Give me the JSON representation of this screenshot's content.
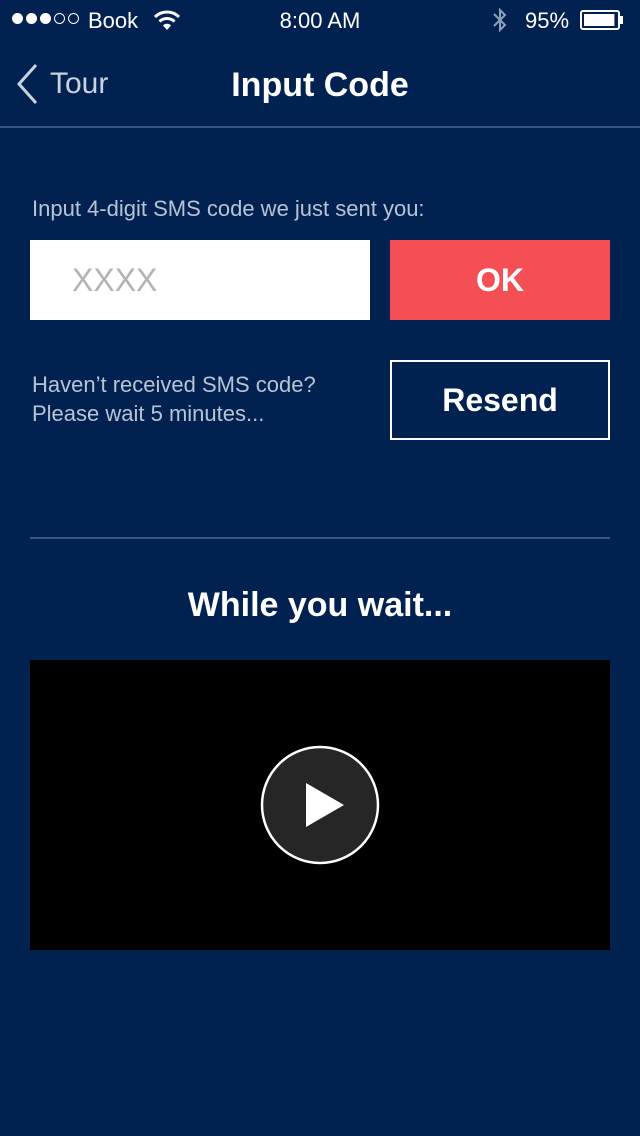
{
  "status_bar": {
    "signal_full_dots": 3,
    "signal_empty_dots": 2,
    "carrier": "Book",
    "time": "8:00 AM",
    "battery_percent": "95%",
    "battery_level": 0.95,
    "icons": [
      "wifi-icon",
      "bluetooth-icon",
      "battery-icon"
    ]
  },
  "nav": {
    "back_label": "Tour",
    "back_icon": "chevron-left-icon",
    "title": "Input Code"
  },
  "code_entry": {
    "prompt": "Input 4-digit SMS code we just sent you:",
    "input_value": "",
    "input_placeholder": "XXXX",
    "ok_label": "OK"
  },
  "resend": {
    "line1": "Haven’t received SMS code?",
    "line2": "Please wait 5 minutes...",
    "button_label": "Resend"
  },
  "video": {
    "section_title": "While you wait...",
    "play_icon": "play-icon"
  },
  "colors": {
    "background": "#012150",
    "accent": "#f44f55",
    "divider": "#3a5685",
    "secondary_text": "#b8c3d4",
    "video_bg": "#000000"
  }
}
